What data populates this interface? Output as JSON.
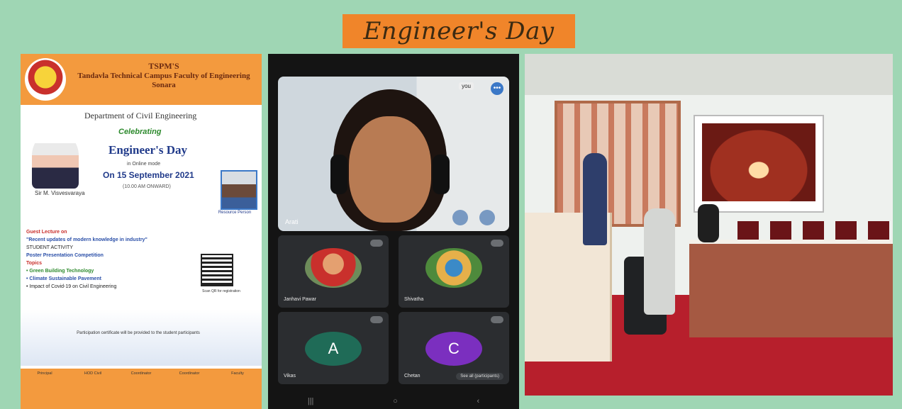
{
  "title": "Engineer's Day",
  "poster": {
    "org_abbr": "TSPM'S",
    "org_name": "Tandavla Technical Campus Faculty of Engineering Sonara",
    "department": "Department of Civil Engineering",
    "celebrating": "Celebrating",
    "event": "Engineer's Day",
    "mode": "in Online mode",
    "date": "On 15 September 2021",
    "time": "(10.00 AM ONWARD)",
    "person_name": "Sir M. Visvesvaraya",
    "speaker_role": "Resource Person",
    "body_lines": [
      "Guest Lecture on",
      "\"Recent updates of modern knowledge in industry\"",
      "STUDENT ACTIVITY",
      "Poster Presentation Competition",
      "Topics",
      "• Green Building Technology",
      "• Climate Sustainable Pavement",
      "• Impact of Covid-19 on Civil Engineering"
    ],
    "qr_caption": "Scan QR for registration",
    "note": "Participation certificate will be provided to the student participants",
    "footer": [
      "Principal",
      "HOD Civil",
      "Coordinator",
      "Coordinator",
      "Faculty"
    ]
  },
  "meeting": {
    "main_name": "Arati",
    "main_tag": "you",
    "tiles": [
      {
        "name": "Janhavi Pawar",
        "type": "photo"
      },
      {
        "name": "Shivatha",
        "type": "photo"
      },
      {
        "name": "Vikas",
        "type": "letter",
        "letter": "A",
        "color": "#1f6b57"
      },
      {
        "name": "Chetan",
        "type": "letter",
        "letter": "C",
        "color": "#7b2fbf",
        "see_all": "See all (participants)"
      }
    ],
    "nav": [
      "|||",
      "○",
      "‹"
    ]
  }
}
